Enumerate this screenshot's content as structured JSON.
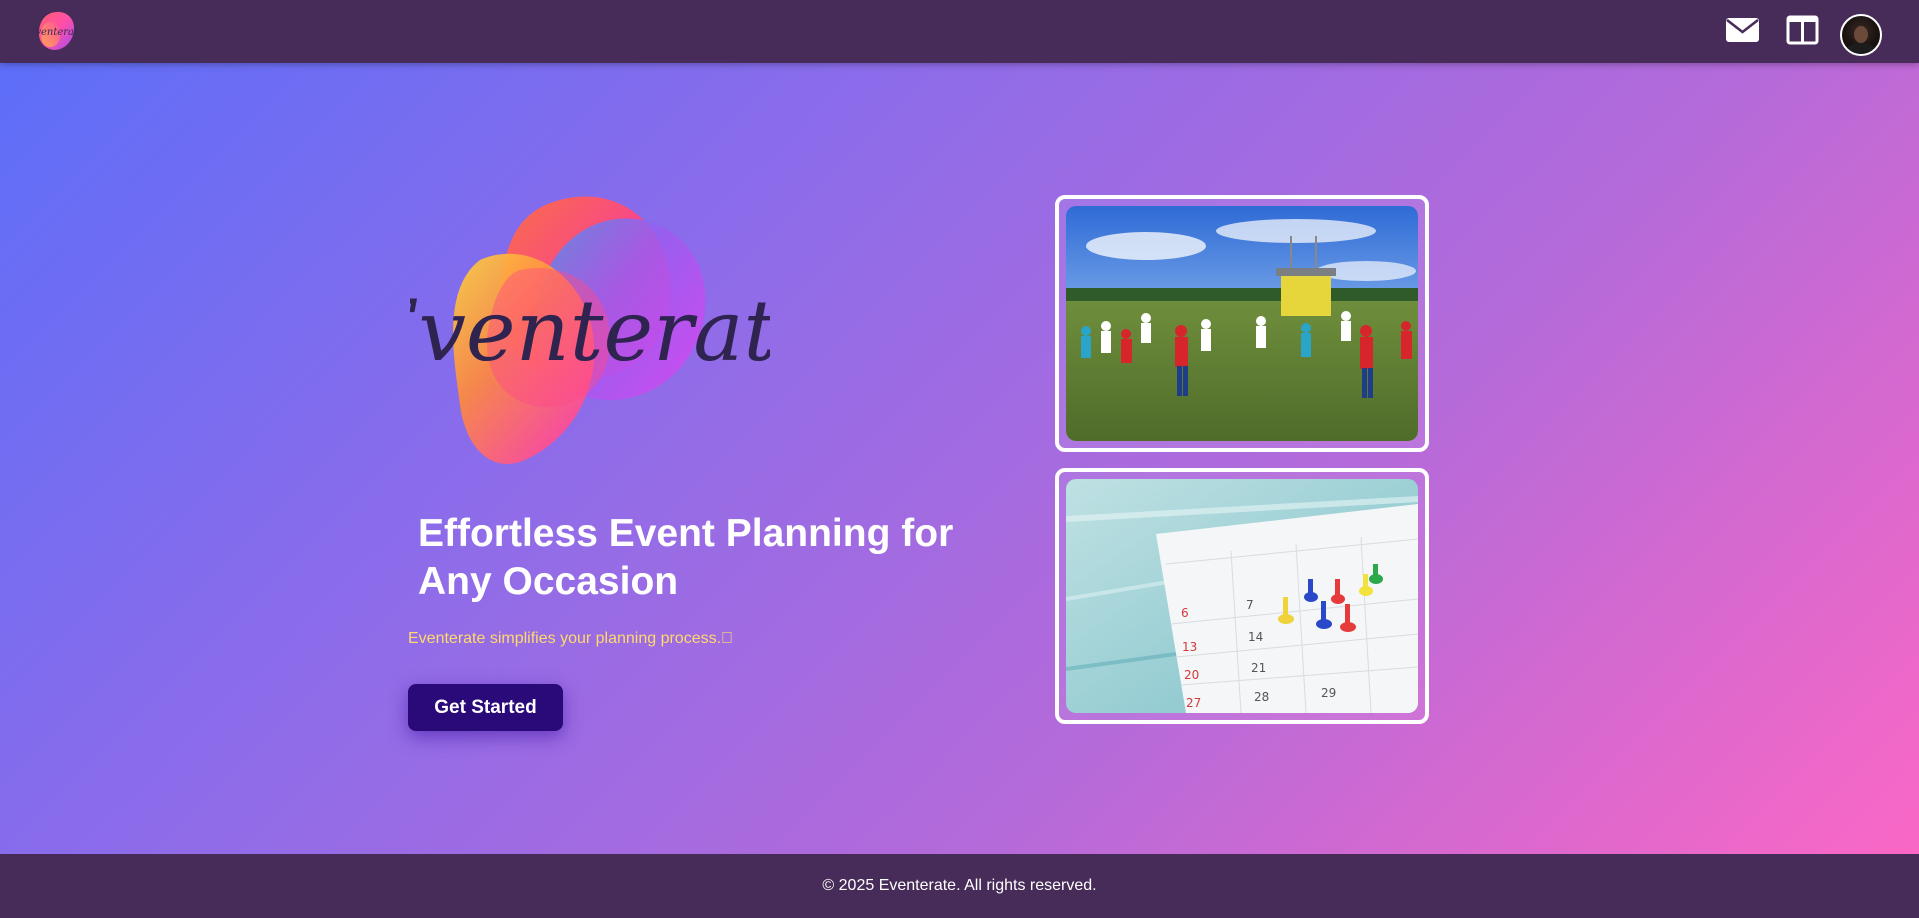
{
  "navbar": {
    "brand_text": "Eventerate",
    "icons": [
      "mail-icon",
      "layout-icon"
    ],
    "avatar_label": "user-avatar",
    "background": "#472b58"
  },
  "hero": {
    "logo_text": "Eventerate",
    "title": "Effortless Event Planning for Any Occasion",
    "subtitle": "Eventerate simplifies your planning process.\u0000",
    "cta_label": "Get Started",
    "subtitle_color": "#ffd96a",
    "cta_color": "#2a0a78"
  },
  "images": [
    {
      "alt": "event-crowd-photo",
      "kind": "outdoor event with children playing"
    },
    {
      "alt": "calendar-pins-photo",
      "kind": "calendar with push pins",
      "dates": [
        "6",
        "7",
        "13",
        "14",
        "20",
        "21",
        "27",
        "28",
        "29"
      ]
    }
  ],
  "footer": {
    "copyright": "© 2025 Eventerate. All rights reserved."
  },
  "colors": {
    "gradient_start": "#5a6ef9",
    "gradient_end": "#ff67c4"
  }
}
